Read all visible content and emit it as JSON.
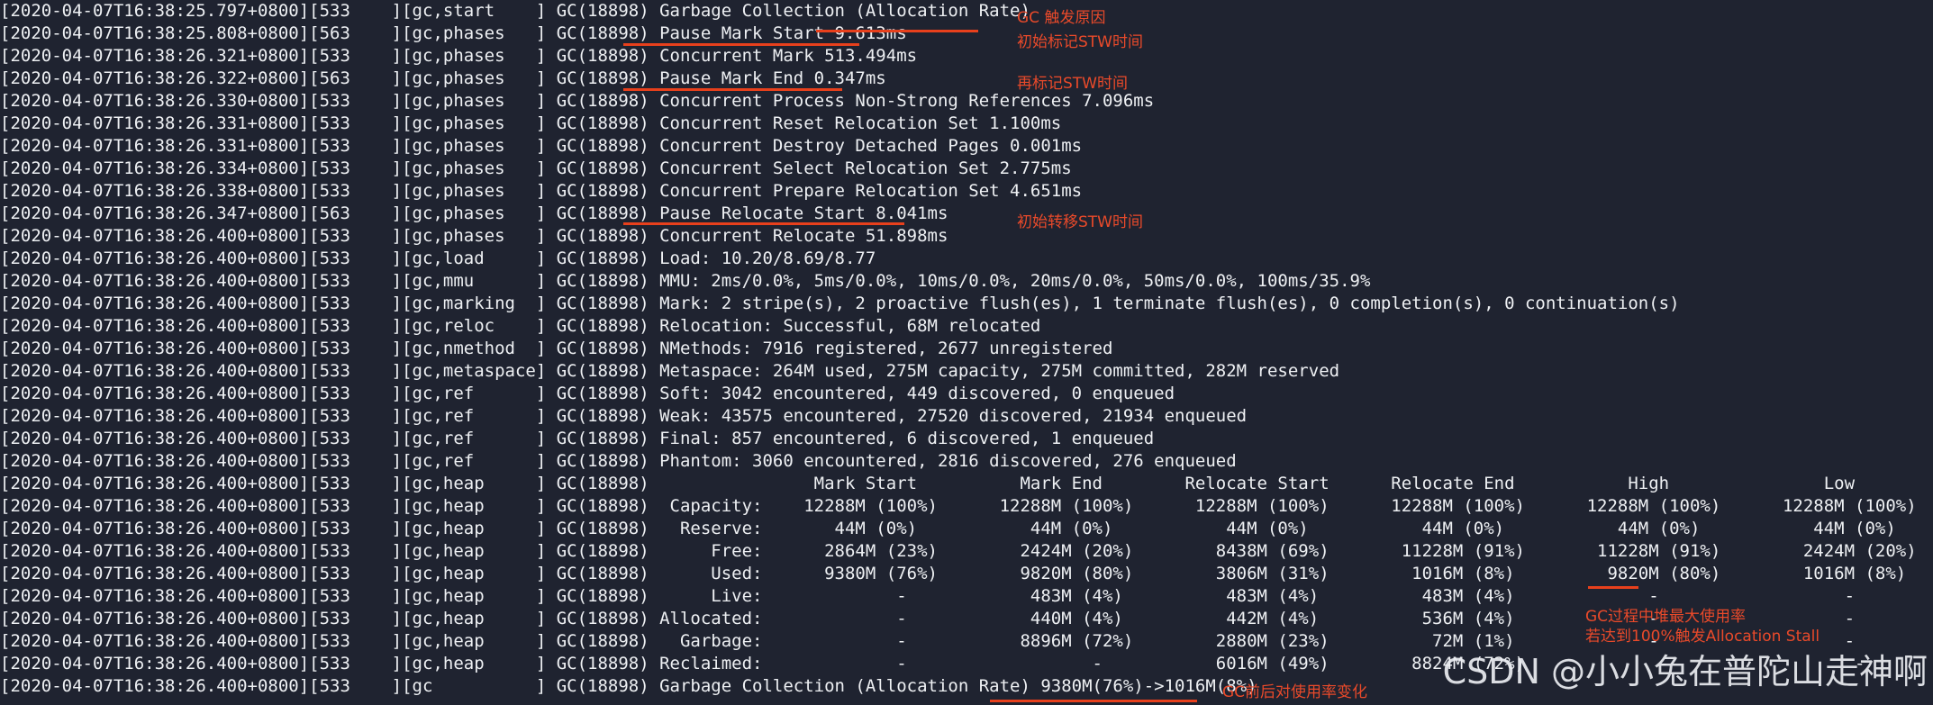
{
  "log": {
    "lines": [
      {
        "prefix": "[2020-04-07T16:38:25.797+0800][533    ][gc,start    ] GC(18898) ",
        "message": "Garbage Collection (Allocation Rate)",
        "hl": ""
      },
      {
        "prefix": "[2020-04-07T16:38:25.808+0800][563    ][gc,phases   ] GC(18898) ",
        "message": "",
        "hl": "Pause Mark Start 9.613ms"
      },
      {
        "prefix": "[2020-04-07T16:38:26.321+0800][533    ][gc,phases   ] GC(18898) ",
        "message": "Concurrent Mark 513.494ms",
        "hl": ""
      },
      {
        "prefix": "[2020-04-07T16:38:26.322+0800][563    ][gc,phases   ] GC(18898) ",
        "message": "",
        "hl": "Pause Mark End 0.347ms"
      },
      {
        "prefix": "[2020-04-07T16:38:26.330+0800][533    ][gc,phases   ] GC(18898) ",
        "message": "Concurrent Process Non-Strong References 7.096ms",
        "hl": ""
      },
      {
        "prefix": "[2020-04-07T16:38:26.331+0800][533    ][gc,phases   ] GC(18898) ",
        "message": "Concurrent Reset Relocation Set 1.100ms",
        "hl": ""
      },
      {
        "prefix": "[2020-04-07T16:38:26.331+0800][533    ][gc,phases   ] GC(18898) ",
        "message": "Concurrent Destroy Detached Pages 0.001ms",
        "hl": ""
      },
      {
        "prefix": "[2020-04-07T16:38:26.334+0800][533    ][gc,phases   ] GC(18898) ",
        "message": "Concurrent Select Relocation Set 2.775ms",
        "hl": ""
      },
      {
        "prefix": "[2020-04-07T16:38:26.338+0800][533    ][gc,phases   ] GC(18898) ",
        "message": "Concurrent Prepare Relocation Set 4.651ms",
        "hl": ""
      },
      {
        "prefix": "[2020-04-07T16:38:26.347+0800][563    ][gc,phases   ] GC(18898) ",
        "message": "",
        "hl": "Pause Relocate Start 8.041ms"
      },
      {
        "prefix": "[2020-04-07T16:38:26.400+0800][533    ][gc,phases   ] GC(18898) ",
        "message": "Concurrent Relocate 51.898ms",
        "hl": ""
      },
      {
        "prefix": "[2020-04-07T16:38:26.400+0800][533    ][gc,load     ] GC(18898) ",
        "message": "Load: 10.20/8.69/8.77",
        "hl": ""
      },
      {
        "prefix": "[2020-04-07T16:38:26.400+0800][533    ][gc,mmu      ] GC(18898) ",
        "message": "MMU: 2ms/0.0%, 5ms/0.0%, 10ms/0.0%, 20ms/0.0%, 50ms/0.0%, 100ms/35.9%",
        "hl": ""
      },
      {
        "prefix": "[2020-04-07T16:38:26.400+0800][533    ][gc,marking  ] GC(18898) ",
        "message": "Mark: 2 stripe(s), 2 proactive flush(es), 1 terminate flush(es), 0 completion(s), 0 continuation(s)",
        "hl": ""
      },
      {
        "prefix": "[2020-04-07T16:38:26.400+0800][533    ][gc,reloc    ] GC(18898) ",
        "message": "Relocation: Successful, 68M relocated",
        "hl": ""
      },
      {
        "prefix": "[2020-04-07T16:38:26.400+0800][533    ][gc,nmethod  ] GC(18898) ",
        "message": "NMethods: 7916 registered, 2677 unregistered",
        "hl": ""
      },
      {
        "prefix": "[2020-04-07T16:38:26.400+0800][533    ][gc,metaspace] GC(18898) ",
        "message": "Metaspace: 264M used, 275M capacity, 275M committed, 282M reserved",
        "hl": ""
      },
      {
        "prefix": "[2020-04-07T16:38:26.400+0800][533    ][gc,ref      ] GC(18898) ",
        "message": "Soft: 3042 encountered, 449 discovered, 0 enqueued",
        "hl": ""
      },
      {
        "prefix": "[2020-04-07T16:38:26.400+0800][533    ][gc,ref      ] GC(18898) ",
        "message": "Weak: 43575 encountered, 27520 discovered, 21934 enqueued",
        "hl": ""
      },
      {
        "prefix": "[2020-04-07T16:38:26.400+0800][533    ][gc,ref      ] GC(18898) ",
        "message": "Final: 857 encountered, 6 discovered, 1 enqueued",
        "hl": ""
      },
      {
        "prefix": "[2020-04-07T16:38:26.400+0800][533    ][gc,ref      ] GC(18898) ",
        "message": "Phantom: 3060 encountered, 2816 discovered, 276 enqueued",
        "hl": ""
      },
      {
        "prefix": "[2020-04-07T16:38:26.400+0800][533    ][gc,heap     ] GC(18898) ",
        "message": "               Mark Start          Mark End        Relocate Start      Relocate End           High               Low",
        "hl": ""
      },
      {
        "prefix": "[2020-04-07T16:38:26.400+0800][533    ][gc,heap     ] GC(18898) ",
        "message": " Capacity:    12288M (100%)      12288M (100%)      12288M (100%)      12288M (100%)      12288M (100%)      12288M (100%)",
        "hl": ""
      },
      {
        "prefix": "[2020-04-07T16:38:26.400+0800][533    ][gc,heap     ] GC(18898) ",
        "message": "  Reserve:       44M (0%)           44M (0%)           44M (0%)           44M (0%)           44M (0%)           44M (0%)",
        "hl": ""
      },
      {
        "prefix": "[2020-04-07T16:38:26.400+0800][533    ][gc,heap     ] GC(18898) ",
        "message": "     Free:      2864M (23%)        2424M (20%)        8438M (69%)       11228M (91%)       11228M (91%)        2424M (20%)",
        "hl": ""
      },
      {
        "prefix": "[2020-04-07T16:38:26.400+0800][533    ][gc,heap     ] GC(18898) ",
        "message": "     Used:      9380M (76%)        9820M (80%)        3806M (31%)        1016M (8%)         9820M (80%)        1016M (8%)",
        "hl": ""
      },
      {
        "prefix": "[2020-04-07T16:38:26.400+0800][533    ][gc,heap     ] GC(18898) ",
        "message": "     Live:             -            483M (4%)          483M (4%)          483M (4%)             -                  -",
        "hl": ""
      },
      {
        "prefix": "[2020-04-07T16:38:26.400+0800][533    ][gc,heap     ] GC(18898) ",
        "message": "Allocated:             -            440M (4%)          442M (4%)          536M (4%)             -                  -",
        "hl": ""
      },
      {
        "prefix": "[2020-04-07T16:38:26.400+0800][533    ][gc,heap     ] GC(18898) ",
        "message": "  Garbage:             -           8896M (72%)        2880M (23%)          72M (1%)             -                  -",
        "hl": ""
      },
      {
        "prefix": "[2020-04-07T16:38:26.400+0800][533    ][gc,heap     ] GC(18898) ",
        "message": "Reclaimed:             -                  -           6016M (49%)        8824M (72%)             -                  -",
        "hl": ""
      },
      {
        "prefix": "[2020-04-07T16:38:26.400+0800][533    ][gc          ] GC(18898) ",
        "message": "Garbage Collection (Allocation Rate) 9380M(76%)->1016M(8%)",
        "hl": ""
      }
    ]
  },
  "annotations": {
    "gc_cause": "GC 触发原因",
    "initial_mark_stw": "初始标记STW时间",
    "remark_stw": "再标记STW时间",
    "initial_relocate_stw": "初始转移STW时间",
    "heap_max_usage_line1": "GC过程中堆最大使用率",
    "heap_max_usage_line2": "若达到100%触发Allocation Stall",
    "usage_change": "GC前后对使用率变化"
  },
  "watermark": "CSDN @小小兔在普陀山走神啊",
  "colors": {
    "background": "#1f2330",
    "text": "#eef0f3",
    "annotation": "#ea4a2a",
    "underline": "#e8401c"
  }
}
